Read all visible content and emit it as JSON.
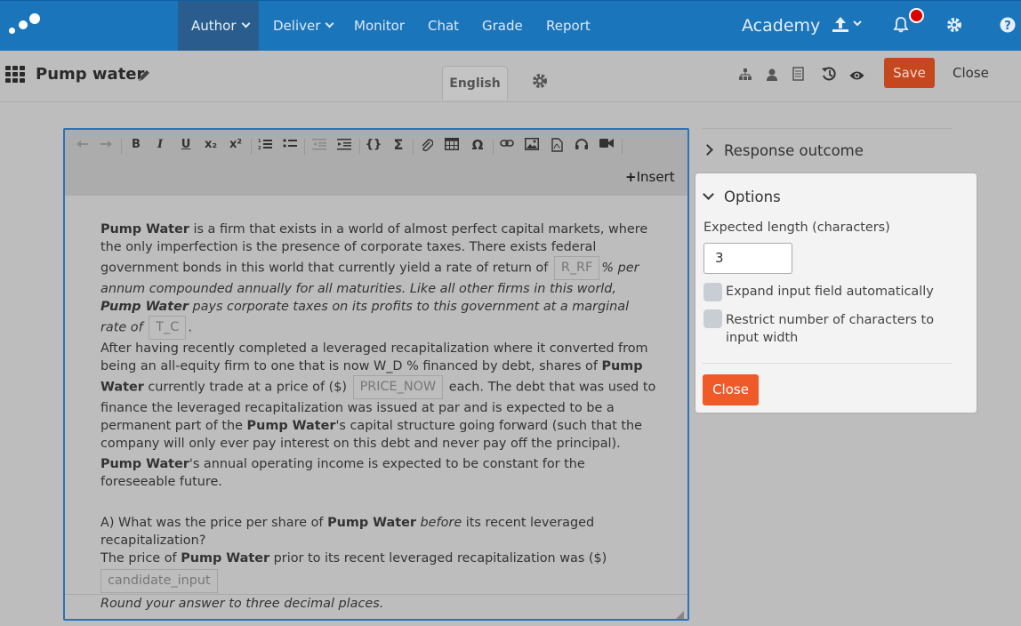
{
  "nav": {
    "items": [
      "Author",
      "Deliver",
      "Monitor",
      "Chat",
      "Grade",
      "Report"
    ],
    "academy": "Academy"
  },
  "question": {
    "title": "Pump water",
    "language_tab": "English",
    "save_label": "Save",
    "close_label": "Close"
  },
  "toolbar": {
    "insert_label": "Insert",
    "buttons": {
      "bold": "B",
      "italic": "I",
      "underline": "U",
      "subscript": "x₂",
      "superscript": "x²",
      "code": "{}",
      "sum": "Σ",
      "omega": "Ω"
    }
  },
  "body": {
    "p1": {
      "a": "Pump Water",
      "b": " is a firm that exists in a world of almost perfect capital markets, where the only imperfection is the presence of corporate taxes. There exists federal government bonds in this world that currently yield a rate of return of ",
      "ph_rrf": "R_RF",
      "c": "% per annum compounded annually for all maturities. Like all other firms in this world, ",
      "d": "Pump Water",
      "e": " pays corporate taxes on its profits to this government at a marginal rate of ",
      "ph_tc": "T_C",
      "f": "."
    },
    "p2": {
      "a": "After having recently completed a leveraged recapitalization where it converted from being an all-equity firm to one that is now W_D % financed by debt, shares of ",
      "b": "Pump Water",
      "c": " currently trade at a price of ($) ",
      "ph_price": "PRICE_NOW",
      "d": " each. The debt that was used to finance the leveraged recapitalization was issued at par and is expected to be a permanent part of the ",
      "e": "Pump Water",
      "f": "'s capital structure going forward (such that the company will only ever pay interest on this debt and never pay off the principal)."
    },
    "p3": {
      "a": "Pump Water",
      "b": "'s annual operating income is expected to be constant for the foreseeable future."
    },
    "q": {
      "a": "A) What was the price per share of ",
      "b": "Pump Water",
      "c": " ",
      "d": "before",
      "e": " its recent leveraged recapitalization?",
      "f": "The price of ",
      "g": "Pump Water",
      "h": " prior to its recent leveraged recapitalization was ($)",
      "input_ph": "candidate_input",
      "note": "Round your answer to three decimal places."
    }
  },
  "sidebar": {
    "response_outcome": "Response outcome",
    "options": "Options",
    "expected_length_label": "Expected length (characters)",
    "expected_length_value": "3",
    "expand_label": "Expand input field automatically",
    "restrict_label": "Restrict number of characters to input width",
    "close_label": "Close"
  },
  "colors": {
    "nav": "#1b75bb",
    "accent": "#f05a28",
    "editor_border": "#2b73b6"
  }
}
